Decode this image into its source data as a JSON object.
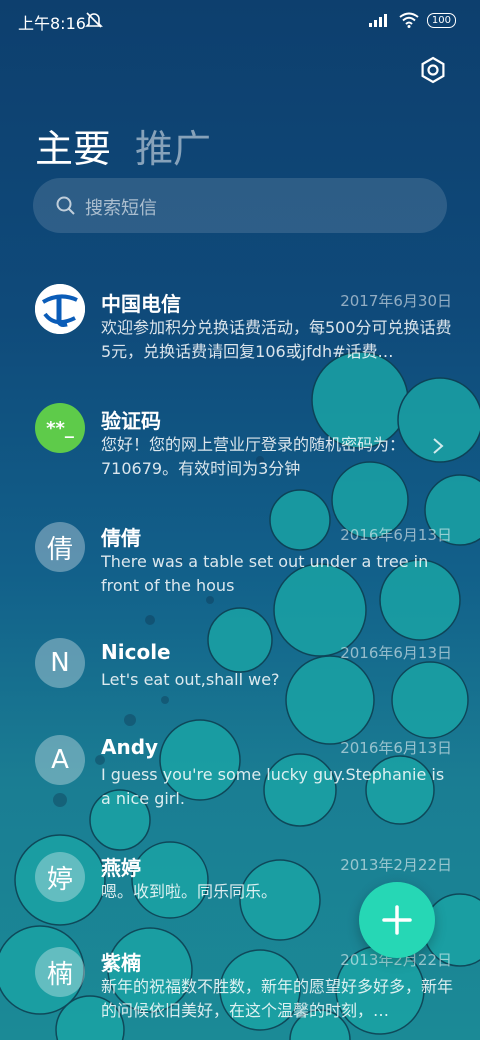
{
  "status": {
    "time": "上午8:16",
    "battery": "100"
  },
  "header": {
    "tab_main": "主要",
    "tab_promo": "推广",
    "settings_icon": "hexagon-settings-icon"
  },
  "search": {
    "placeholder": "搜索短信"
  },
  "conversations": [
    {
      "name": "中国电信",
      "date": "2017年6月30日",
      "preview": "欢迎参加积分兑换话费活动，每500分可兑换话费5元，兑换话费请回复106或jfdh#话费…",
      "avatar": "telecom-logo"
    },
    {
      "name": "验证码",
      "date": "",
      "preview": "您好！您的网上营业厅登录的随机密码为：710679。有效时间为3分钟",
      "avatar_text": "**_",
      "avatar_color": "#5ecb4a"
    },
    {
      "name": "倩倩",
      "date": "2016年6月13日",
      "preview": "There was a table set out under a tree in front of the hous",
      "avatar_text": "倩"
    },
    {
      "name": "Nicole",
      "date": "2016年6月13日",
      "preview": "Let's eat out,shall we?",
      "avatar_text": "N"
    },
    {
      "name": "Andy",
      "date": "2016年6月13日",
      "preview": "I guess you're some lucky guy.Stephanie is a nice girl.",
      "avatar_text": "A"
    },
    {
      "name": "燕婷",
      "date": "2013年2月22日",
      "preview": "嗯。收到啦。同乐同乐。",
      "avatar_text": "婷"
    },
    {
      "name": "紫楠",
      "date": "2013年2月22日",
      "preview": "新年的祝福数不胜数，新年的愿望好多好多，新年的问候依旧美好，在这个温馨的时刻，…",
      "avatar_text": "楠"
    }
  ],
  "colors": {
    "accent": "#26d7b5",
    "telecom_blue": "#0a5cb8"
  }
}
